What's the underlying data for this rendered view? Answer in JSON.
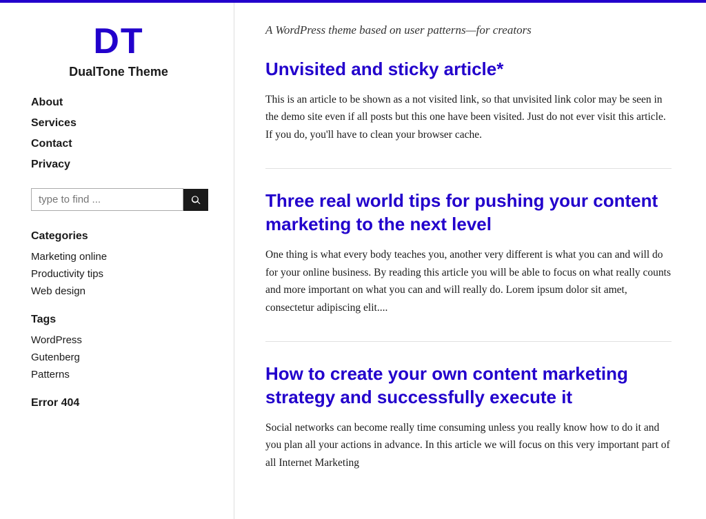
{
  "site": {
    "logo_d": "D",
    "logo_t": "T",
    "title": "DualTone Theme",
    "tagline": "A WordPress theme based on user patterns—for creators"
  },
  "nav": {
    "items": [
      {
        "label": "About",
        "href": "#"
      },
      {
        "label": "Services",
        "href": "#"
      },
      {
        "label": "Contact",
        "href": "#"
      },
      {
        "label": "Privacy",
        "href": "#"
      }
    ]
  },
  "search": {
    "placeholder": "type to find ...",
    "button_label": "Search"
  },
  "categories": {
    "title": "Categories",
    "items": [
      {
        "label": "Marketing online",
        "href": "#"
      },
      {
        "label": "Productivity tips",
        "href": "#"
      },
      {
        "label": "Web design",
        "href": "#"
      }
    ]
  },
  "tags": {
    "title": "Tags",
    "items": [
      {
        "label": "WordPress",
        "href": "#"
      },
      {
        "label": "Gutenberg",
        "href": "#"
      },
      {
        "label": "Patterns",
        "href": "#"
      }
    ]
  },
  "error_label": "Error 404",
  "articles": [
    {
      "title": "Unvisited and sticky article*",
      "excerpt": "This is an article to be shown as a not visited link, so that unvisited link color may be seen in the demo site even if all posts but this one have been visited. Just do not ever visit this article. If you do, you'll have to clean your browser cache."
    },
    {
      "title": "Three real world tips for pushing your content marketing to the next level",
      "excerpt": "One thing is what every body teaches you, another very different is what you can and will do for your online business. By reading this article you will be able to focus on what really counts and more important on what you can and will really do. Lorem ipsum dolor sit amet, consectetur adipiscing elit...."
    },
    {
      "title": "How to create your own content marketing strategy and successfully execute it",
      "excerpt": "Social networks can become really time consuming unless you really know how to do it and you plan all your actions in advance. In this article we will focus on this very important part of all Internet Marketing"
    }
  ]
}
